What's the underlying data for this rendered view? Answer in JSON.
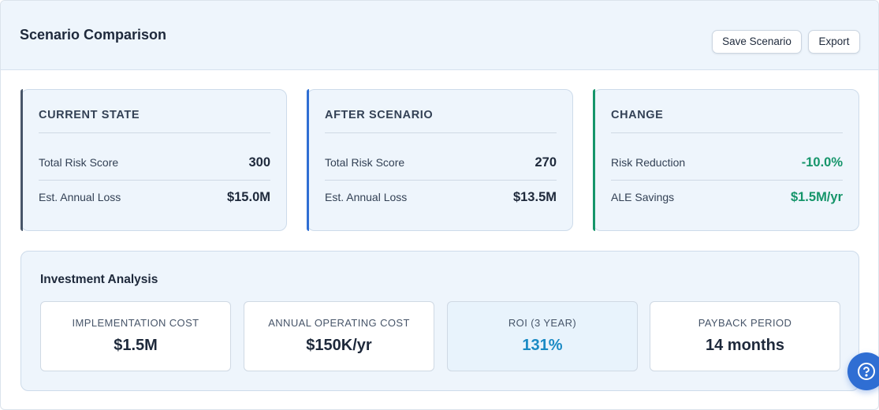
{
  "header": {
    "title": "Scenario Comparison",
    "save_label": "Save Scenario",
    "export_label": "Export"
  },
  "cards": {
    "current": {
      "title": "CURRENT STATE",
      "row1_label": "Total Risk Score",
      "row1_value": "300",
      "row2_label": "Est. Annual Loss",
      "row2_value": "$15.0M",
      "accent": "#475569"
    },
    "after": {
      "title": "AFTER SCENARIO",
      "row1_label": "Total Risk Score",
      "row1_value": "270",
      "row2_label": "Est. Annual Loss",
      "row2_value": "$13.5M",
      "accent": "#2f6ed3"
    },
    "change": {
      "title": "CHANGE",
      "row1_label": "Risk Reduction",
      "row1_value": "-10.0%",
      "row2_label": "ALE Savings",
      "row2_value": "$1.5M/yr",
      "accent": "#15956a"
    }
  },
  "investment": {
    "title": "Investment Analysis",
    "metrics": [
      {
        "label": "IMPLEMENTATION COST",
        "value": "$1.5M"
      },
      {
        "label": "ANNUAL OPERATING COST",
        "value": "$150K/yr"
      },
      {
        "label": "ROI (3 YEAR)",
        "value": "131%"
      },
      {
        "label": "PAYBACK PERIOD",
        "value": "14 months"
      }
    ]
  },
  "help": {
    "icon": "help-circle-icon"
  }
}
